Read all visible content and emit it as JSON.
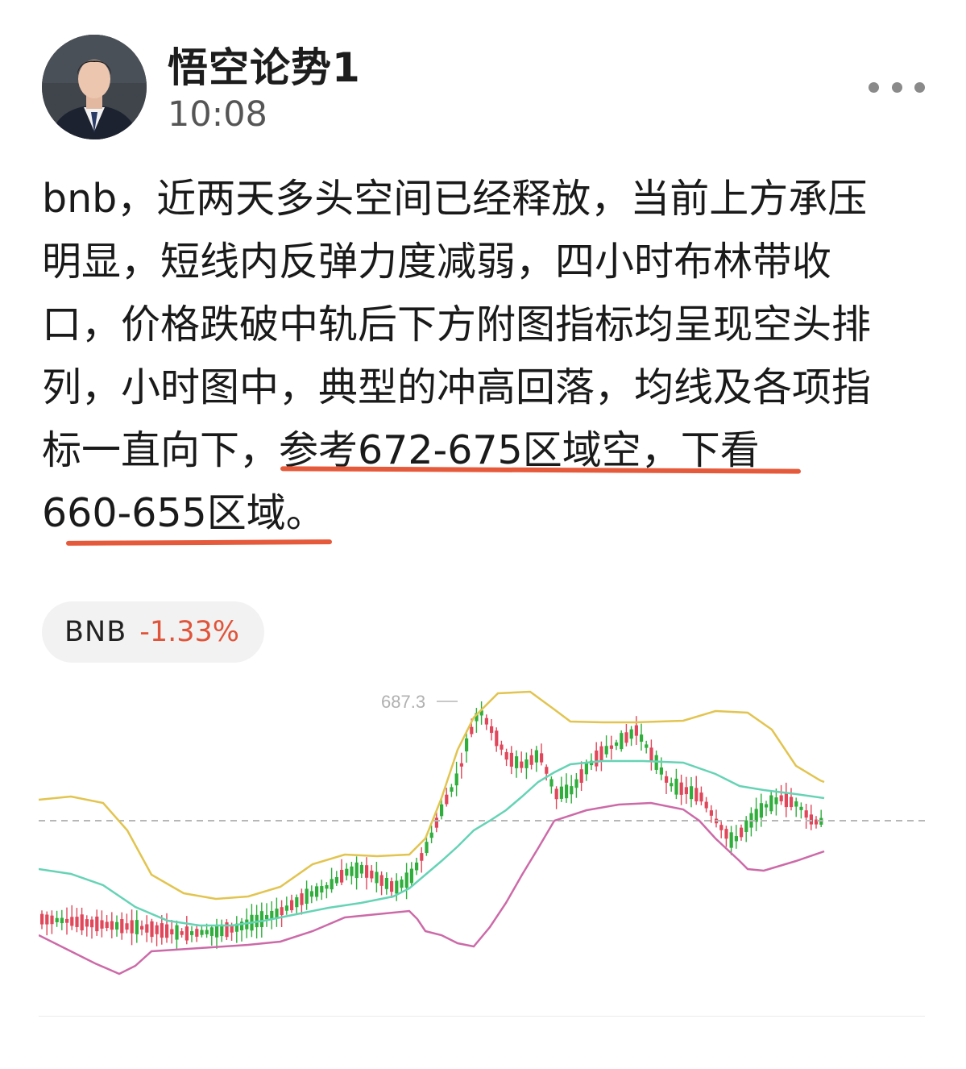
{
  "author": {
    "name": "悟空论势1",
    "time": "10:08"
  },
  "post": {
    "lines": [
      "bnb，近两天多头空间已经释放，当前上方承压",
      "明显，短线内反弹力度减弱，四小时布林带收",
      "口，价格跌破中轨后下方附图指标均呈现空头排",
      "列，小时图中，典型的冲高回落，均线及各项指",
      "标一直向下，参考672-675区域空，下看",
      "660-655区域。"
    ]
  },
  "ticker": {
    "symbol": "BNB",
    "change": "-1.33%"
  },
  "colors": {
    "accent_red": "#e65a3c",
    "candle_up": "#2fae3c",
    "candle_down": "#e0475a",
    "band_upper": "#e2c44f",
    "band_middle": "#66d3b5",
    "band_lower": "#cc6aa8"
  },
  "icons": {
    "more": "more-horizontal-icon"
  },
  "chart_data": {
    "type": "candlestick",
    "max_label": "687.3",
    "reference_line": "dashed horizontal current price line",
    "overlays": [
      "bollinger upper band",
      "bollinger middle band",
      "bollinger lower band"
    ]
  }
}
